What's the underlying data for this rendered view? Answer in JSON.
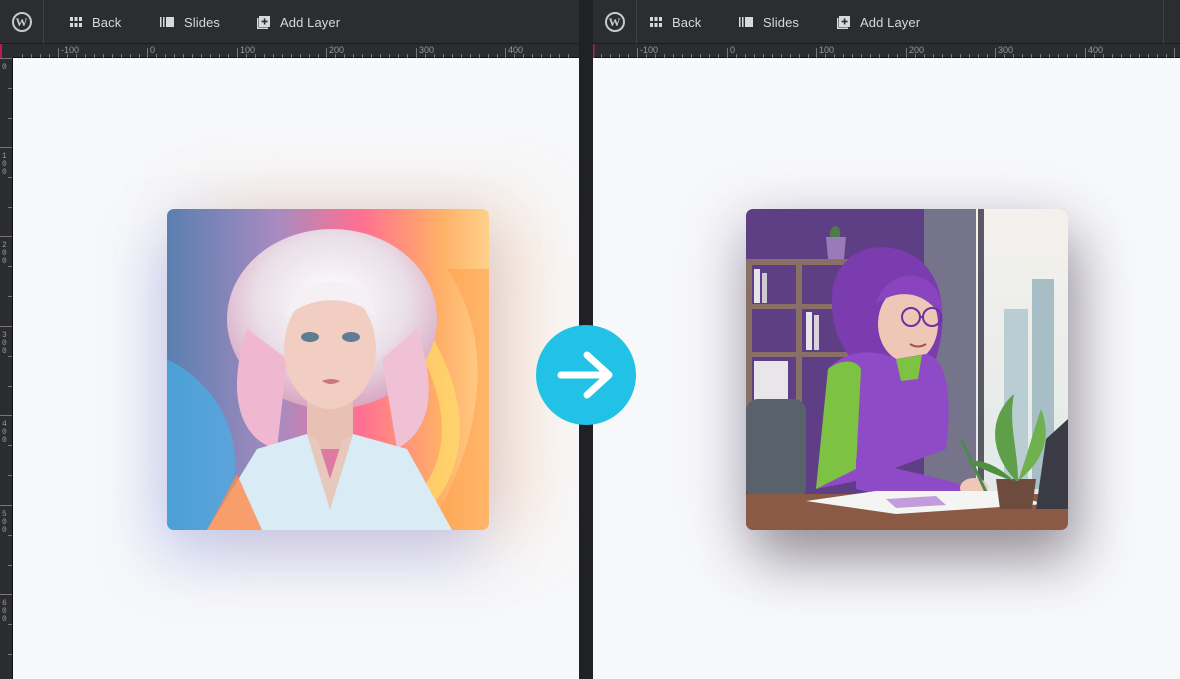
{
  "toolbar": {
    "wp_icon": "wordpress-icon",
    "back_label": "Back",
    "slides_label": "Slides",
    "add_layer_label": "Add Layer"
  },
  "rulers": {
    "left_h_ticks": [
      "-100",
      "0",
      "100",
      "200",
      "300",
      "400"
    ],
    "right_h_ticks": [
      "-100",
      "0",
      "100",
      "200",
      "300",
      "400"
    ],
    "v_ticks": [
      "0",
      "100",
      "200",
      "300",
      "400",
      "500",
      "600"
    ]
  },
  "panels": {
    "left": {
      "image": "portrait-woman-white-hair-colorful-background"
    },
    "right": {
      "image": "illustration-woman-purple-hair-at-desk"
    }
  },
  "transition_icon": "arrow-right-icon",
  "colors": {
    "toolbar_bg": "#2b2d31",
    "canvas_bg": "#f7f8fa",
    "accent_arrow": "#22c2e6",
    "ruler_marker": "#c2185b"
  }
}
